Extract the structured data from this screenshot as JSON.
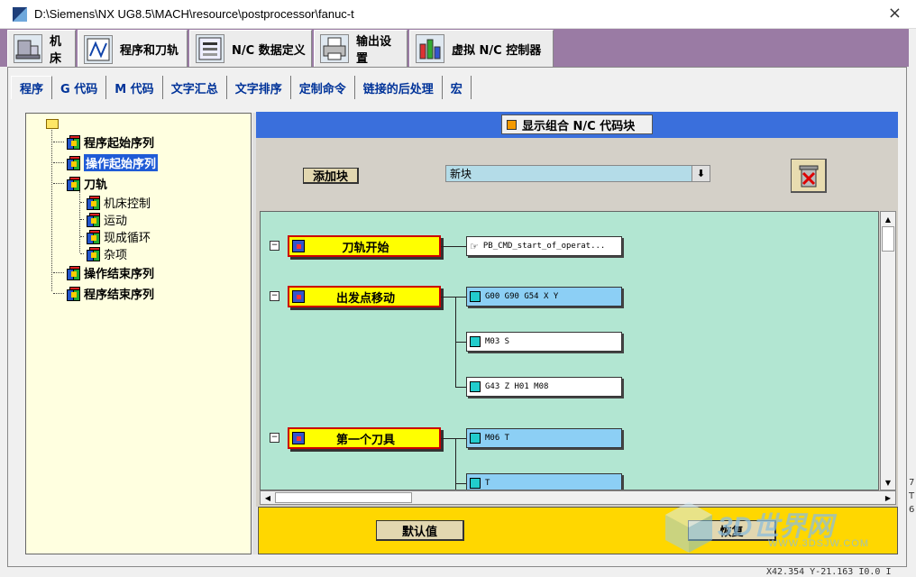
{
  "window": {
    "title": "D:\\Siemens\\NX UG8.5\\MACH\\resource\\postprocessor\\fanuc-t",
    "close_glyph": "×"
  },
  "top_tabs": [
    {
      "label": "机床",
      "icon": "machine-tool-icon"
    },
    {
      "label": "程序和刀轨",
      "icon": "program-toolpath-icon"
    },
    {
      "label": "N/C 数据定义",
      "icon": "nc-data-icon"
    },
    {
      "label": "输出设置",
      "icon": "printer-icon"
    },
    {
      "label": "虚拟 N/C 控制器",
      "icon": "virtual-controller-icon"
    }
  ],
  "sub_tabs": [
    "程序",
    "G 代码",
    "M 代码",
    "文字汇总",
    "文字排序",
    "定制命令",
    "链接的后处理",
    "宏"
  ],
  "tree": {
    "items": [
      {
        "label": "程序起始序列",
        "bold": true
      },
      {
        "label": "操作起始序列",
        "bold": true,
        "selected": true
      },
      {
        "label": "刀轨",
        "bold": true
      },
      {
        "label": "机床控制",
        "bold": false
      },
      {
        "label": "运动",
        "bold": false
      },
      {
        "label": "现成循环",
        "bold": false
      },
      {
        "label": "杂项",
        "bold": false
      },
      {
        "label": "操作结束序列",
        "bold": true
      },
      {
        "label": "程序结束序列",
        "bold": true
      }
    ]
  },
  "header": {
    "toggle_label": "显示组合 N/C 代码块",
    "accent": "#3a6fdc"
  },
  "controls": {
    "add_block_label": "添加块",
    "new_block_value": "新块",
    "dropdown_glyph": "⬇"
  },
  "blocks": [
    {
      "label": "刀轨开始",
      "words": [
        {
          "text": "PB_CMD_start_of_operat...",
          "style": "white",
          "kind": "command"
        }
      ]
    },
    {
      "label": "出发点移动",
      "words": [
        {
          "text": "G00 G90 G54 X Y",
          "style": "blue",
          "kind": "block"
        },
        {
          "text": "M03 S",
          "style": "white",
          "kind": "block"
        },
        {
          "text": "G43 Z H01 M08",
          "style": "white",
          "kind": "block"
        }
      ]
    },
    {
      "label": "第一个刀具",
      "words": [
        {
          "text": "M06 T",
          "style": "blue",
          "kind": "block"
        },
        {
          "text": "T",
          "style": "blue",
          "kind": "block"
        }
      ]
    }
  ],
  "footer": {
    "default_label": "默认值",
    "restore_label": "恢复",
    "accent": "#ffd700"
  },
  "watermark": {
    "big": "3D世界网",
    "small": "WWW.3DSJW.COM"
  },
  "background_text": {
    "status": "X42.354 Y-21.163 I0.0 I",
    "right_chars": [
      "7",
      "T",
      "6"
    ]
  }
}
